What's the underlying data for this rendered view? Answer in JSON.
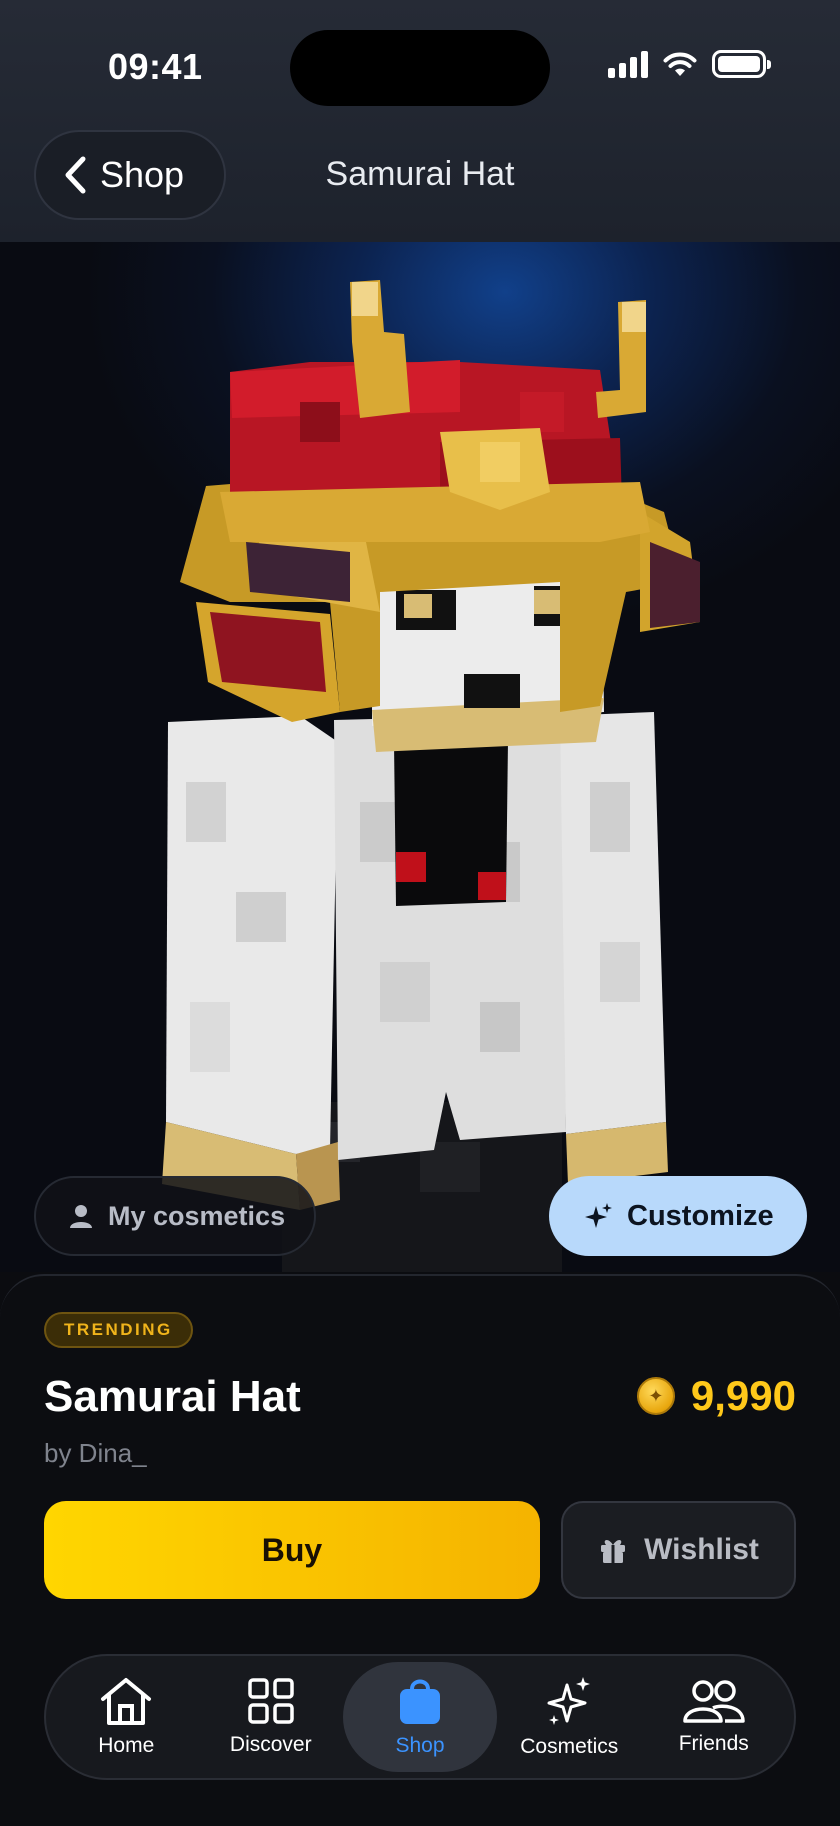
{
  "status_bar": {
    "time": "09:41"
  },
  "header": {
    "back_label": "Shop",
    "title": "Samurai Hat"
  },
  "preview": {
    "my_cosmetics_label": "My cosmetics",
    "customize_label": "Customize"
  },
  "product": {
    "badge": "TRENDING",
    "name": "Samurai Hat",
    "creator": "by Dina_",
    "price": "9,990",
    "buy_label": "Buy",
    "wishlist_label": "Wishlist"
  },
  "tabs": [
    {
      "label": "Home",
      "icon": "home-icon"
    },
    {
      "label": "Discover",
      "icon": "grid-icon"
    },
    {
      "label": "Shop",
      "icon": "shopping-bag-icon",
      "active": true
    },
    {
      "label": "Cosmetics",
      "icon": "sparkles-icon"
    },
    {
      "label": "Friends",
      "icon": "people-icon"
    }
  ],
  "colors": {
    "accent_blue": "#3b93ff",
    "buy_yellow": "#ffd600",
    "price_gold": "#ffc81a",
    "customize_bg": "#b8d9fb"
  }
}
